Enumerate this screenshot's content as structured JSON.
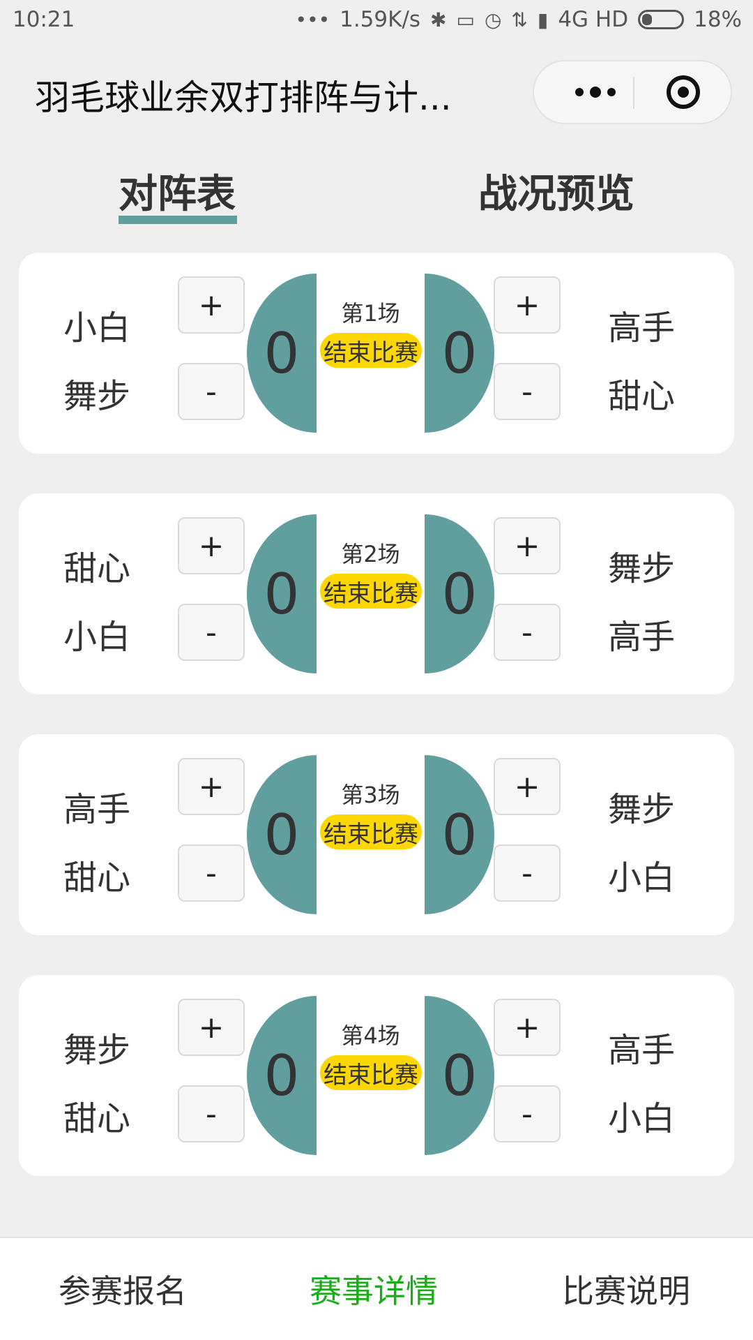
{
  "status_bar": {
    "time": "10:21",
    "network_speed": "1.59K/s",
    "network_type": "4G HD",
    "battery": "18%"
  },
  "header": {
    "title": "羽毛球业余双打排阵与计..."
  },
  "tabs": [
    {
      "label": "对阵表",
      "active": true
    },
    {
      "label": "战况预览",
      "active": false
    }
  ],
  "controls": {
    "plus": "+",
    "minus": "-",
    "end_match": "结束比赛"
  },
  "matches": [
    {
      "title": "第1场",
      "left_team": [
        "小白",
        "舞步"
      ],
      "right_team": [
        "高手",
        "甜心"
      ],
      "left_score": "0",
      "right_score": "0"
    },
    {
      "title": "第2场",
      "left_team": [
        "甜心",
        "小白"
      ],
      "right_team": [
        "舞步",
        "高手"
      ],
      "left_score": "0",
      "right_score": "0"
    },
    {
      "title": "第3场",
      "left_team": [
        "高手",
        "甜心"
      ],
      "right_team": [
        "舞步",
        "小白"
      ],
      "left_score": "0",
      "right_score": "0"
    },
    {
      "title": "第4场",
      "left_team": [
        "舞步",
        "甜心"
      ],
      "right_team": [
        "高手",
        "小白"
      ],
      "left_score": "0",
      "right_score": "0"
    }
  ],
  "bottom_nav": [
    {
      "label": "参赛报名",
      "active": false
    },
    {
      "label": "赛事详情",
      "active": true
    },
    {
      "label": "比赛说明",
      "active": false
    }
  ],
  "colors": {
    "accent_teal": "#619e9e",
    "end_button_yellow": "#ffd700",
    "nav_active_green": "#1aad19",
    "background": "#efefef"
  }
}
